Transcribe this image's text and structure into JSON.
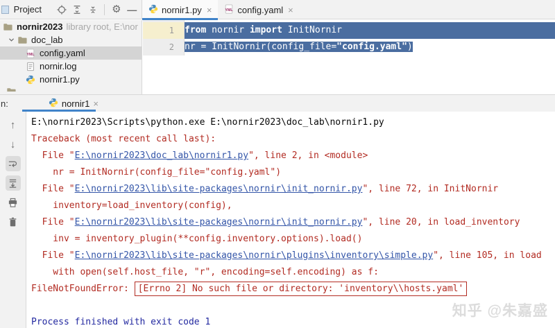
{
  "colors": {
    "accent": "#4083C9",
    "selection": "#4A6DA0",
    "selected_row": "#D4D4D4",
    "gutter_active": "#F6EFCE",
    "error": "#B22B22",
    "link": "#3355A8",
    "system": "#2329A0",
    "watermark": "#DCDCDC"
  },
  "project_panel": {
    "title": "Project",
    "header_icons": [
      "locate",
      "expand-all",
      "collapse-all",
      "divider",
      "settings",
      "hide"
    ],
    "tree": [
      {
        "icon": "folder",
        "label": "nornir2023",
        "bold": true,
        "suffix": "library root, E:\\nor",
        "indent": 0
      },
      {
        "icon": "folder",
        "label": "doc_lab",
        "indent": 1,
        "chevron": true
      },
      {
        "icon": "yml",
        "label": "config.yaml",
        "indent": 2,
        "selected": true
      },
      {
        "icon": "log",
        "label": "nornir.log",
        "indent": 2
      },
      {
        "icon": "py",
        "label": "nornir1.py",
        "indent": 2
      },
      {
        "icon": "folder",
        "label": "",
        "indent": 1,
        "clipped": true
      }
    ]
  },
  "editor": {
    "tabs": [
      {
        "icon": "py",
        "label": "nornir1.py",
        "active": true,
        "close": "×"
      },
      {
        "icon": "yml",
        "label": "config.yaml",
        "active": false,
        "close": "×"
      }
    ],
    "lines": [
      {
        "num": "1",
        "gutter_highlight": true,
        "selection_full_width": true,
        "segments": [
          {
            "t": "from",
            "cls": "kw"
          },
          {
            "t": " nornir "
          },
          {
            "t": "import",
            "cls": "kw"
          },
          {
            "t": " InitNornir"
          }
        ]
      },
      {
        "num": "2",
        "gutter_highlight": false,
        "selection_full_width": false,
        "segments": [
          {
            "t": "nr = InitNornir(config_file="
          },
          {
            "t": "\"config.yaml\"",
            "cls": "str"
          },
          {
            "t": ")"
          }
        ]
      }
    ]
  },
  "run_panel": {
    "label": "n:",
    "tab": {
      "icon": "py",
      "label": "nornir1",
      "close": "×"
    },
    "toolbar": [
      {
        "name": "rerun-up",
        "selected": false
      },
      {
        "name": "down",
        "selected": false
      },
      {
        "name": "soft-wrap",
        "selected": true
      },
      {
        "name": "scroll-to-end",
        "selected": true
      },
      {
        "name": "print",
        "selected": false
      },
      {
        "name": "clear-all",
        "selected": false
      }
    ],
    "console_lines": [
      [
        {
          "t": "E:\\nornir2023\\Scripts\\python.exe E:\\nornir2023\\doc_lab\\nornir1.py",
          "s": "plain"
        }
      ],
      [
        {
          "t": "Traceback (most recent call last):",
          "s": "err"
        }
      ],
      [
        {
          "t": "  File \"",
          "s": "err"
        },
        {
          "t": "E:\\nornir2023\\doc_lab\\nornir1.py",
          "s": "link"
        },
        {
          "t": "\", line 2, in <module>",
          "s": "err"
        }
      ],
      [
        {
          "t": "    nr = InitNornir(config_file=\"config.yaml\")",
          "s": "err"
        }
      ],
      [
        {
          "t": "  File \"",
          "s": "err"
        },
        {
          "t": "E:\\nornir2023\\lib\\site-packages\\nornir\\init_nornir.py",
          "s": "link"
        },
        {
          "t": "\", line 72, in InitNornir",
          "s": "err"
        }
      ],
      [
        {
          "t": "    inventory=load_inventory(config),",
          "s": "err"
        }
      ],
      [
        {
          "t": "  File \"",
          "s": "err"
        },
        {
          "t": "E:\\nornir2023\\lib\\site-packages\\nornir\\init_nornir.py",
          "s": "link"
        },
        {
          "t": "\", line 20, in load_inventory",
          "s": "err"
        }
      ],
      [
        {
          "t": "    inv = inventory_plugin(**config.inventory.options).load()",
          "s": "err"
        }
      ],
      [
        {
          "t": "  File \"",
          "s": "err"
        },
        {
          "t": "E:\\nornir2023\\lib\\site-packages\\nornir\\plugins\\inventory\\simple.py",
          "s": "link"
        },
        {
          "t": "\", line 105, in load",
          "s": "err"
        }
      ],
      [
        {
          "t": "    with open(self.host_file, \"r\", encoding=self.encoding) as f:",
          "s": "err"
        }
      ],
      [
        {
          "t": "FileNotFoundError: ",
          "s": "err"
        },
        {
          "t": "[Errno 2] No such file or directory: 'inventory\\\\hosts.yaml'",
          "s": "boxed"
        }
      ],
      [],
      [
        {
          "t": "Process finished with exit code 1",
          "s": "sys"
        }
      ]
    ]
  },
  "watermark": "知乎 @朱嘉盛"
}
